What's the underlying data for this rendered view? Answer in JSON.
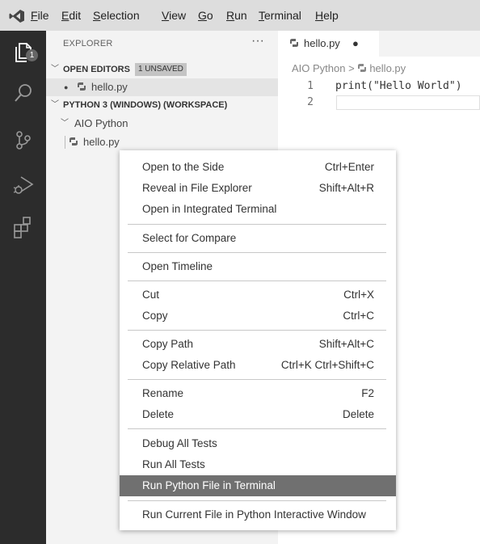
{
  "menubar": {
    "items": [
      {
        "pre": "",
        "mn": "F",
        "post": "ile"
      },
      {
        "pre": "",
        "mn": "E",
        "post": "dit"
      },
      {
        "pre": "",
        "mn": "S",
        "post": "election"
      },
      {
        "pre": "",
        "mn": "V",
        "post": "iew"
      },
      {
        "pre": "",
        "mn": "G",
        "post": "o"
      },
      {
        "pre": "",
        "mn": "R",
        "post": "un"
      },
      {
        "pre": "",
        "mn": "T",
        "post": "erminal"
      },
      {
        "pre": "",
        "mn": "H",
        "post": "elp"
      }
    ]
  },
  "activity": {
    "icons": [
      "explorer-icon",
      "search-icon",
      "source-control-icon",
      "run-debug-icon",
      "extensions-icon"
    ],
    "badge": "1"
  },
  "sidebar": {
    "title": "EXPLORER",
    "more": "···",
    "open_editors": {
      "label": "OPEN EDITORS",
      "badge": "1 UNSAVED",
      "file": "hello.py"
    },
    "workspace": {
      "label": "PYTHON 3 (WINDOWS) (WORKSPACE)",
      "folder": "AIO Python",
      "file": "hello.py"
    }
  },
  "editor": {
    "tab": {
      "label": "hello.py",
      "dirty": "●"
    },
    "breadcrumb": {
      "folder": "AIO Python",
      "sep": ">",
      "file": "hello.py"
    },
    "lines": [
      {
        "n": "1",
        "code": "print(\"Hello World\")"
      },
      {
        "n": "2",
        "code": ""
      }
    ]
  },
  "context_menu": {
    "groups": [
      [
        {
          "label": "Open to the Side",
          "shortcut": "Ctrl+Enter"
        },
        {
          "label": "Reveal in File Explorer",
          "shortcut": "Shift+Alt+R"
        },
        {
          "label": "Open in Integrated Terminal",
          "shortcut": ""
        }
      ],
      [
        {
          "label": "Select for Compare",
          "shortcut": ""
        }
      ],
      [
        {
          "label": "Open Timeline",
          "shortcut": ""
        }
      ],
      [
        {
          "label": "Cut",
          "shortcut": "Ctrl+X"
        },
        {
          "label": "Copy",
          "shortcut": "Ctrl+C"
        }
      ],
      [
        {
          "label": "Copy Path",
          "shortcut": "Shift+Alt+C"
        },
        {
          "label": "Copy Relative Path",
          "shortcut": "Ctrl+K Ctrl+Shift+C"
        }
      ],
      [
        {
          "label": "Rename",
          "shortcut": "F2"
        },
        {
          "label": "Delete",
          "shortcut": "Delete"
        }
      ],
      [
        {
          "label": "Debug All Tests",
          "shortcut": ""
        },
        {
          "label": "Run All Tests",
          "shortcut": ""
        },
        {
          "label": "Run Python File in Terminal",
          "shortcut": "",
          "highlighted": true
        }
      ],
      [
        {
          "label": "Run Current File in Python Interactive Window",
          "shortcut": ""
        }
      ]
    ]
  },
  "colors": {
    "activity_bar": "#2c2c2c",
    "sidebar": "#f3f3f3",
    "menu_highlight": "#707070"
  }
}
